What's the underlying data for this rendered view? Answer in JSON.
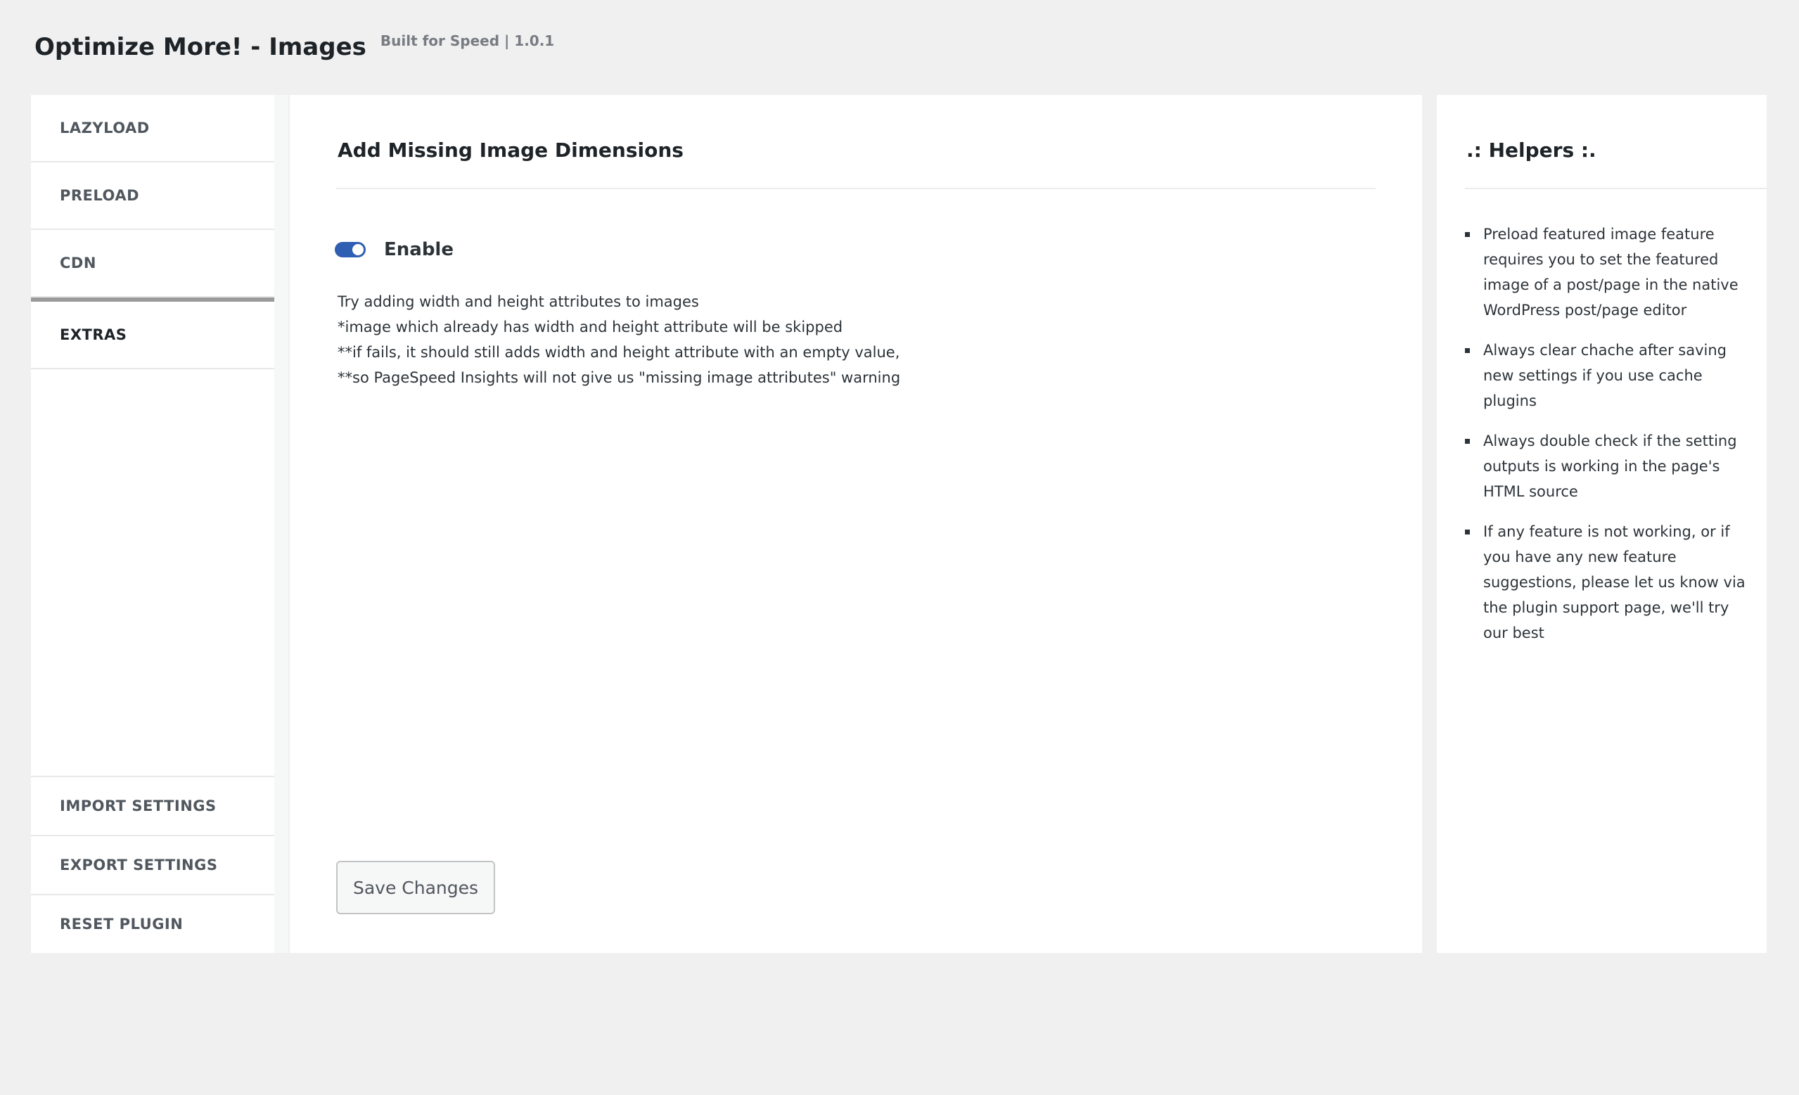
{
  "header": {
    "title": "Optimize More! - Images",
    "meta": "Built for Speed | 1.0.1"
  },
  "sidebar": {
    "items": [
      {
        "label": "LAZYLOAD",
        "active": false
      },
      {
        "label": "PRELOAD",
        "active": false
      },
      {
        "label": "CDN",
        "active": false
      },
      {
        "label": "EXTRAS",
        "active": true
      }
    ],
    "bottom_items": [
      {
        "label": "IMPORT SETTINGS"
      },
      {
        "label": "EXPORT SETTINGS"
      },
      {
        "label": "RESET PLUGIN"
      }
    ]
  },
  "main": {
    "section_title": "Add Missing Image Dimensions",
    "toggle": {
      "label": "Enable",
      "enabled": true,
      "color": "#2f5fb3"
    },
    "description": [
      "Try adding width and height attributes to images",
      "*image which already has width and height attribute will be skipped",
      "**if fails, it should still adds width and height attribute with an empty value,",
      "**so PageSpeed Insights will not give us \"missing image attributes\" warning"
    ],
    "save_label": "Save Changes"
  },
  "helpers": {
    "title": ".: Helpers :.",
    "items": [
      "Preload featured image feature requires you to set the featured image of a post/page in the native WordPress post/page editor",
      "Always clear chache after saving new settings if you use cache plugins",
      "Always double check if the setting outputs is working in the page's HTML source",
      "If any feature is not working, or if you have any new feature suggestions, please let us know via the plugin support page, we'll try our best"
    ]
  }
}
